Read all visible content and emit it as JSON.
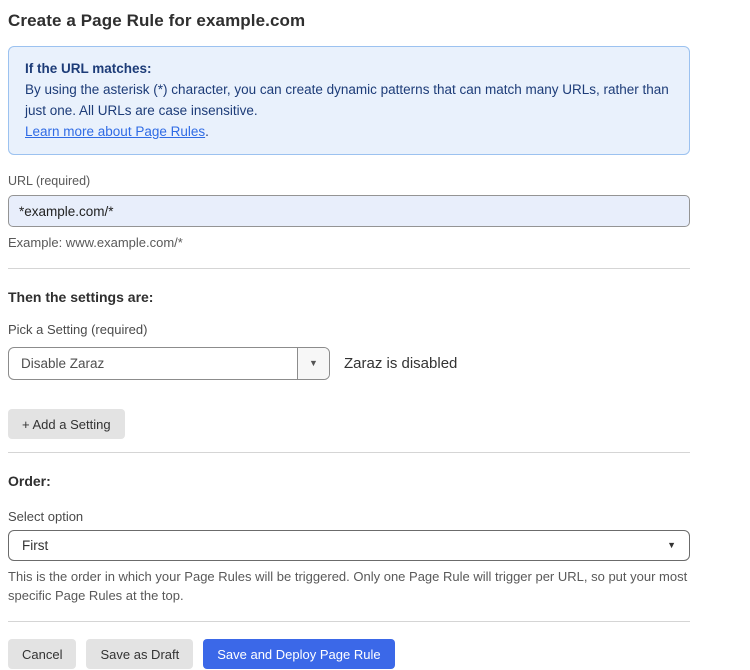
{
  "page": {
    "title": "Create a Page Rule for example.com"
  },
  "info_box": {
    "heading": "If the URL matches:",
    "body": "By using the asterisk (*) character, you can create dynamic patterns that can match many URLs, rather than just one. All URLs are case insensitive.",
    "link_label": "Learn more about Page Rules",
    "link_suffix": "."
  },
  "url_field": {
    "label": "URL (required)",
    "value": "*example.com/*",
    "example": "Example: www.example.com/*"
  },
  "settings_section": {
    "heading": "Then the settings are:",
    "picker_label": "Pick a Setting (required)",
    "selected_setting": "Disable Zaraz",
    "setting_status": "Zaraz is disabled",
    "add_setting_label": "+ Add a Setting"
  },
  "order_section": {
    "heading": "Order:",
    "select_label": "Select option",
    "selected_option": "First",
    "help_text": "This is the order in which your Page Rules will be triggered. Only one Page Rule will trigger per URL, so put your most specific Page Rules at the top."
  },
  "actions": {
    "cancel_label": "Cancel",
    "save_draft_label": "Save as Draft",
    "save_deploy_label": "Save and Deploy Page Rule"
  },
  "icons": {
    "dropdown_arrow": "▼"
  },
  "colors": {
    "accent_blue": "#3b68e8",
    "info_bg": "#e9f1fc",
    "info_border": "#9cc2f0",
    "info_text": "#1d3c78",
    "link_blue": "#2f6be5",
    "input_filled_bg": "#e8eefb"
  }
}
